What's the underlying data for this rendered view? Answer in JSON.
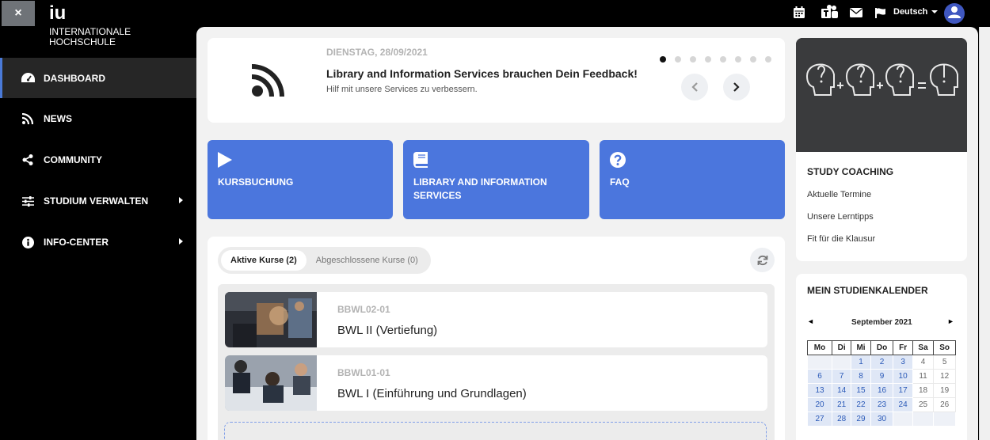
{
  "sidebar": {
    "close_label": "×",
    "logo": {
      "main": "iu",
      "line1": "INTERNATIONALE",
      "line2": "HOCHSCHULE"
    },
    "items": [
      {
        "label": "DASHBOARD",
        "icon": "dashboard-icon",
        "active": true
      },
      {
        "label": "NEWS",
        "icon": "rss-icon"
      },
      {
        "label": "COMMUNITY",
        "icon": "share-icon"
      },
      {
        "label": "STUDIUM VERWALTEN",
        "icon": "sliders-icon",
        "submenu": true
      },
      {
        "label": "INFO-CENTER",
        "icon": "info-icon",
        "submenu": true
      }
    ]
  },
  "topbar": {
    "language": "Deutsch",
    "icons": [
      "calendar-icon",
      "teams-icon",
      "mail-icon",
      "flag-icon",
      "user-icon"
    ]
  },
  "news": {
    "date": "DIENSTAG, 28/09/2021",
    "title": "Library and Information Services brauchen Dein Feedback!",
    "subtitle": "Hilf mit unsere Services zu verbessern.",
    "dots_total": 8,
    "dot_active": 1
  },
  "tiles": [
    {
      "label": "KURSBUCHUNG",
      "icon": "play-icon"
    },
    {
      "label": "LIBRARY AND INFORMATION SERVICES",
      "icon": "book-icon"
    },
    {
      "label": "FAQ",
      "icon": "question-icon"
    }
  ],
  "courses": {
    "tabs": [
      {
        "label": "Aktive Kurse (2)",
        "active": true
      },
      {
        "label": "Abgeschlossene Kurse (0)"
      }
    ],
    "items": [
      {
        "code": "BBWL02-01",
        "name": "BWL II (Vertiefung)"
      },
      {
        "code": "BBWL01-01",
        "name": "BWL I (Einführung und Grundlagen)"
      }
    ]
  },
  "coaching": {
    "title": "STUDY COACHING",
    "links": [
      "Aktuelle Termine",
      "Unsere Lerntipps",
      "Fit für die Klausur"
    ]
  },
  "calendar": {
    "title": "MEIN STUDIENKALENDER",
    "prev": "◄",
    "next": "►",
    "month": "September 2021",
    "weekdays": [
      "Mo",
      "Di",
      "Mi",
      "Do",
      "Fr",
      "Sa",
      "So"
    ],
    "weeks": [
      [
        "",
        "",
        "1",
        "2",
        "3",
        "4",
        "5"
      ],
      [
        "6",
        "7",
        "8",
        "9",
        "10",
        "11",
        "12"
      ],
      [
        "13",
        "14",
        "15",
        "16",
        "17",
        "18",
        "19"
      ],
      [
        "20",
        "21",
        "22",
        "23",
        "24",
        "25",
        "26"
      ],
      [
        "27",
        "28",
        "29",
        "30",
        "",
        "",
        ""
      ]
    ]
  }
}
